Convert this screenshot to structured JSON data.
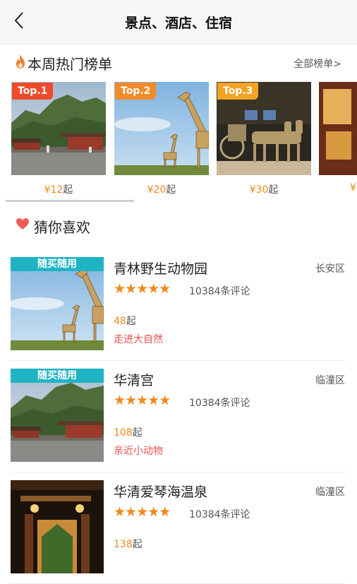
{
  "header": {
    "title": "景点、酒店、住宿",
    "back_icon": "chevron-left-icon"
  },
  "hot": {
    "title": "本周热门榜单",
    "all_link": "全部榜单>",
    "icon": "flame-icon",
    "items": [
      {
        "badge": "Top.1",
        "badge_color": "#f04a2b",
        "price": "¥12",
        "unit": "起"
      },
      {
        "badge": "Top.2",
        "badge_color": "#f38a2a",
        "price": "¥20",
        "unit": "起"
      },
      {
        "badge": "Top.3",
        "badge_color": "#f3a324",
        "price": "¥30",
        "unit": "起"
      },
      {
        "badge": "",
        "badge_color": "#f3a324",
        "price": "¥",
        "unit": ""
      }
    ]
  },
  "guess": {
    "title": "猜你喜欢",
    "icon": "heart-icon",
    "items": [
      {
        "tag": "随买随用",
        "name": "青林野生动物园",
        "district": "长安区",
        "stars": "★★★★★",
        "reviews": "10384条评论",
        "price": "48",
        "unit": "起",
        "slogan": "走进大自然"
      },
      {
        "tag": "随买随用",
        "name": "华清宫",
        "district": "临潼区",
        "stars": "★★★★★",
        "reviews": "10384条评论",
        "price": "108",
        "unit": "起",
        "slogan": "亲近小动物"
      },
      {
        "tag": "",
        "name": "华清爱琴海温泉",
        "district": "临潼区",
        "stars": "★★★★★",
        "reviews": "10384条评论",
        "price": "138",
        "unit": "起",
        "slogan": ""
      }
    ]
  },
  "colors": {
    "accent": "#f0891c",
    "tag": "#1eb4c4",
    "slogan": "#e8514f"
  }
}
